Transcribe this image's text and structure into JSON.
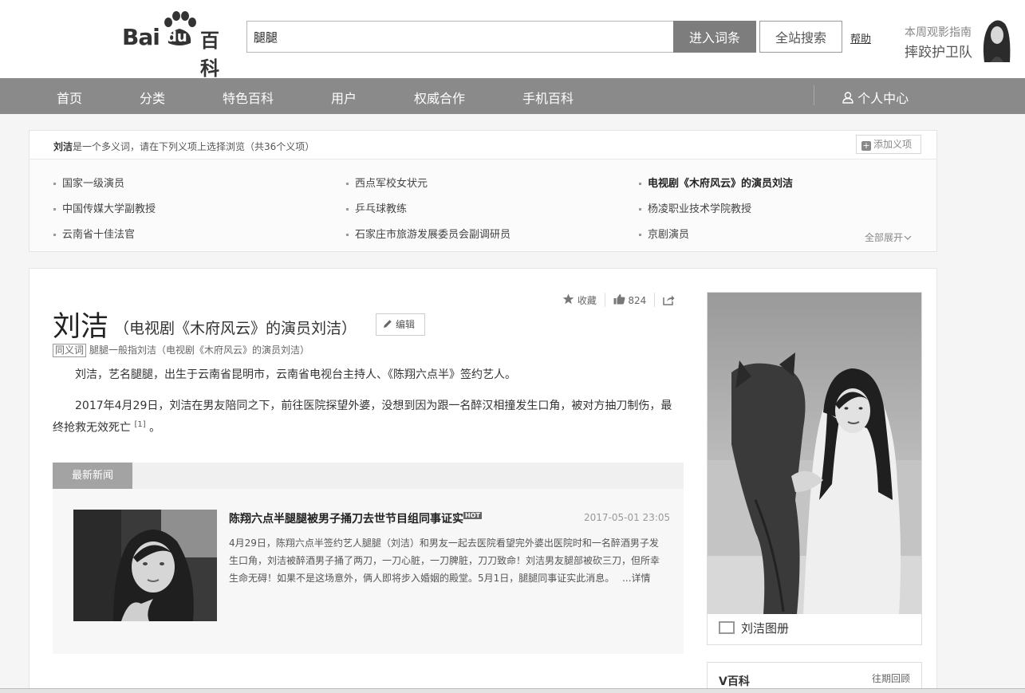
{
  "header": {
    "logo_bai": "Bai",
    "logo_du": "du",
    "logo_baike": "百科",
    "search_value": "腿腿",
    "enter_button": "进入词条",
    "site_search_button": "全站搜索",
    "help_link": "帮助",
    "promo_line1": "本周观影指南",
    "promo_line2": "摔跤护卫队"
  },
  "nav": {
    "items": [
      "首页",
      "分类",
      "特色百科",
      "用户",
      "权威合作",
      "手机百科"
    ],
    "personal": "个人中心"
  },
  "polysemant": {
    "name": "刘洁",
    "intro": "是一个多义词，请在下列义项上选择浏览（共36个义项）",
    "add_button": "添加义项",
    "items": [
      "国家一级演员",
      "西点军校女状元",
      "电视剧《木府风云》的演员刘洁",
      "中国传媒大学副教授",
      "乒乓球教练",
      "杨凌职业技术学院教授",
      "云南省十佳法官",
      "石家庄市旅游发展委员会副调研员",
      "京剧演员"
    ],
    "expand_all": "全部展开"
  },
  "article": {
    "favorite": "收藏",
    "like_count": "824",
    "title": "刘洁",
    "subtitle": "（电视剧《木府风云》的演员刘洁）",
    "edit_button": "编辑",
    "synonym_tag": "同义词",
    "synonym_text": "腿腿一般指刘洁（电视剧《木府风云》的演员刘洁）",
    "para1": "刘洁，艺名腿腿，出生于云南省昆明市，云南省电视台主持人、《陈翔六点半》签约艺人。",
    "para2": "2017年4月29日，刘洁在男友陪同之下，前往医院探望外婆，没想到因为跟一名醉汉相撞发生口角，被对方抽刀制伤，最终抢救无效死亡",
    "para2_ref": "[1]",
    "para2_end": "。"
  },
  "news": {
    "tab": "最新新闻",
    "title": "陈翔六点半腿腿被男子捅刀去世节目组同事证实",
    "hot": "HOT",
    "date": "2017-05-01 23:05",
    "body": "4月29日，陈翔六点半签约艺人腿腿（刘洁）和男友一起去医院看望完外婆出医院时和一名醉酒男子发生口角，刘洁被醉酒男子捅了两刀，一刀心脏，一刀脾脏，刀刀致命！刘洁男友腿部被砍三刀，但所幸生命无碍！如果不是这场意外，俩人即将步入婚姻的殿堂。5月1日，腿腿同事证实此消息。",
    "more": "...详情"
  },
  "sidebar": {
    "album_caption": "刘洁图册",
    "vbaike_title": "V百科",
    "vbaike_more": "往期回顾"
  }
}
